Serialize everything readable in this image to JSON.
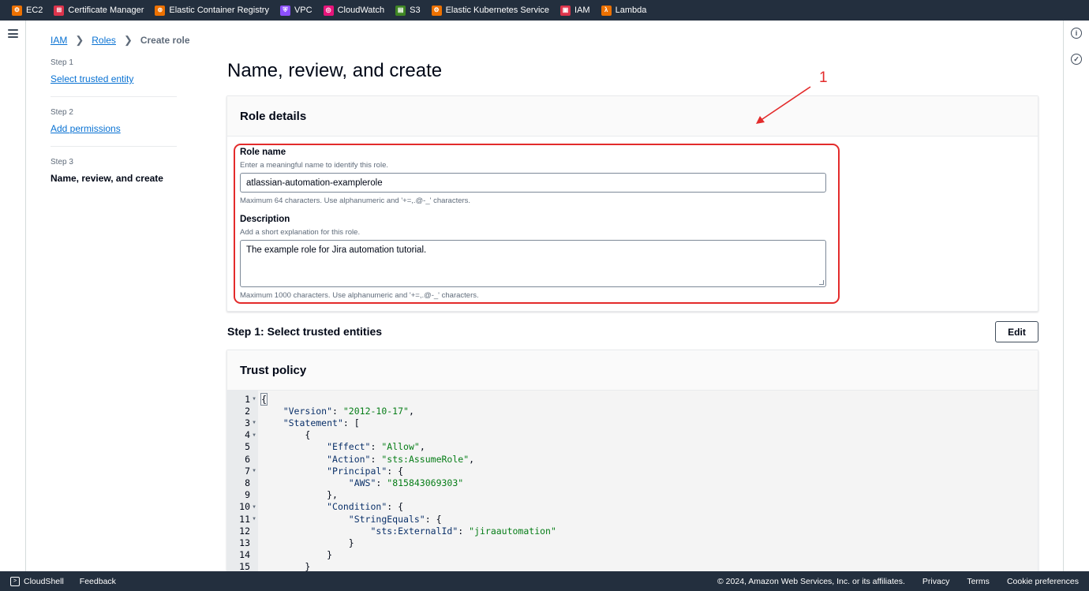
{
  "topbar": {
    "services": [
      {
        "label": "EC2",
        "icon": "ec2-icon",
        "color": "#ed7100",
        "glyph": "⚙"
      },
      {
        "label": "Certificate Manager",
        "icon": "certificate-manager-icon",
        "color": "#dd344c",
        "glyph": "⊞"
      },
      {
        "label": "Elastic Container Registry",
        "icon": "ecr-icon",
        "color": "#ed7100",
        "glyph": "⊚"
      },
      {
        "label": "VPC",
        "icon": "vpc-icon",
        "color": "#8c4fff",
        "glyph": "⛨"
      },
      {
        "label": "CloudWatch",
        "icon": "cloudwatch-icon",
        "color": "#e7157b",
        "glyph": "◎"
      },
      {
        "label": "S3",
        "icon": "s3-icon",
        "color": "#3f8624",
        "glyph": "▤"
      },
      {
        "label": "Elastic Kubernetes Service",
        "icon": "eks-icon",
        "color": "#ed7100",
        "glyph": "⚙"
      },
      {
        "label": "IAM",
        "icon": "iam-icon",
        "color": "#dd344c",
        "glyph": "▣"
      },
      {
        "label": "Lambda",
        "icon": "lambda-icon",
        "color": "#ed7100",
        "glyph": "λ"
      }
    ]
  },
  "breadcrumb": {
    "items": [
      "IAM",
      "Roles"
    ],
    "current": "Create role"
  },
  "steps": [
    {
      "num": "Step 1",
      "label": "Select trusted entity",
      "link": true
    },
    {
      "num": "Step 2",
      "label": "Add permissions",
      "link": true
    },
    {
      "num": "Step 3",
      "label": "Name, review, and create",
      "link": false
    }
  ],
  "page_title": "Name, review, and create",
  "role_details": {
    "header": "Role details",
    "role_name": {
      "label": "Role name",
      "description": "Enter a meaningful name to identify this role.",
      "value": "atlassian-automation-examplerole",
      "constraint": "Maximum 64 characters. Use alphanumeric and '+=,.@-_' characters."
    },
    "description": {
      "label": "Description",
      "description": "Add a short explanation for this role.",
      "value": "The example role for Jira automation tutorial.",
      "constraint": "Maximum 1000 characters. Use alphanumeric and '+=,.@-_' characters."
    }
  },
  "annotation": {
    "number": "1",
    "color": "#e32b2b"
  },
  "trusted_entities": {
    "title": "Step 1: Select trusted entities",
    "edit_label": "Edit",
    "trust_policy_header": "Trust policy",
    "code_lines": [
      {
        "n": "1",
        "fold": true,
        "text": "{"
      },
      {
        "n": "2",
        "fold": false,
        "text": "    \"Version\": \"2012-10-17\","
      },
      {
        "n": "3",
        "fold": true,
        "text": "    \"Statement\": ["
      },
      {
        "n": "4",
        "fold": true,
        "text": "        {"
      },
      {
        "n": "5",
        "fold": false,
        "text": "            \"Effect\": \"Allow\","
      },
      {
        "n": "6",
        "fold": false,
        "text": "            \"Action\": \"sts:AssumeRole\","
      },
      {
        "n": "7",
        "fold": true,
        "text": "            \"Principal\": {"
      },
      {
        "n": "8",
        "fold": false,
        "text": "                \"AWS\": \"815843069303\""
      },
      {
        "n": "9",
        "fold": false,
        "text": "            },"
      },
      {
        "n": "10",
        "fold": true,
        "text": "            \"Condition\": {"
      },
      {
        "n": "11",
        "fold": true,
        "text": "                \"StringEquals\": {"
      },
      {
        "n": "12",
        "fold": false,
        "text": "                    \"sts:ExternalId\": \"jiraautomation\""
      },
      {
        "n": "13",
        "fold": false,
        "text": "                }"
      },
      {
        "n": "14",
        "fold": false,
        "text": "            }"
      },
      {
        "n": "15",
        "fold": false,
        "text": "        }"
      }
    ]
  },
  "footer": {
    "cloudshell": "CloudShell",
    "feedback": "Feedback",
    "copyright": "© 2024, Amazon Web Services, Inc. or its affiliates.",
    "privacy": "Privacy",
    "terms": "Terms",
    "cookie": "Cookie preferences"
  }
}
